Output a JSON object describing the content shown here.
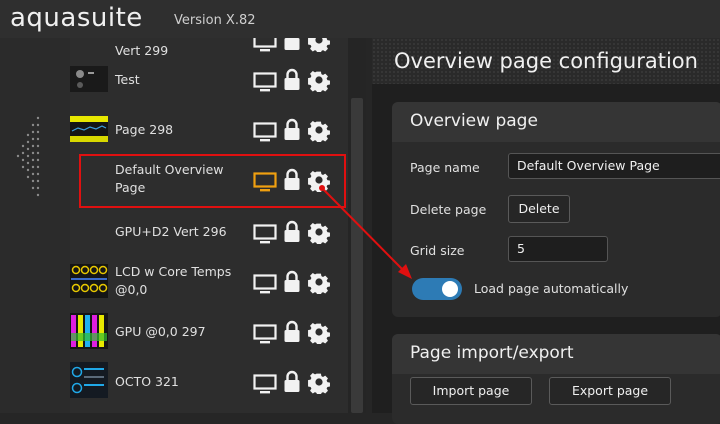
{
  "app": {
    "brand": "aquasuite",
    "version": "Version X.82"
  },
  "sidebar": {
    "items": [
      {
        "label": "Vert 299"
      },
      {
        "label": "Test"
      },
      {
        "label": "Page 298"
      },
      {
        "label": "Default Overview Page"
      },
      {
        "label": "GPU+D2 Vert 296"
      },
      {
        "label": "LCD w Core Temps @0,0"
      },
      {
        "label": "GPU @0,0 297"
      },
      {
        "label": "OCTO 321"
      }
    ],
    "icons": [
      "monitor-icon",
      "lock-icon",
      "gear-icon"
    ],
    "active_monitor_color": "#f0a010"
  },
  "main": {
    "title": "Overview page configuration",
    "overview_card": {
      "title": "Overview page",
      "page_name_label": "Page name",
      "page_name_value": "Default Overview Page",
      "delete_label": "Delete page",
      "delete_button": "Delete",
      "grid_label": "Grid size",
      "grid_value": "5",
      "autoload_label": "Load page automatically",
      "autoload_on": true
    },
    "import_card": {
      "title": "Page import/export",
      "import_button": "Import page",
      "export_button": "Export page"
    }
  },
  "colors": {
    "toggle": "#2d7bb5",
    "annotation": "#e01010"
  }
}
